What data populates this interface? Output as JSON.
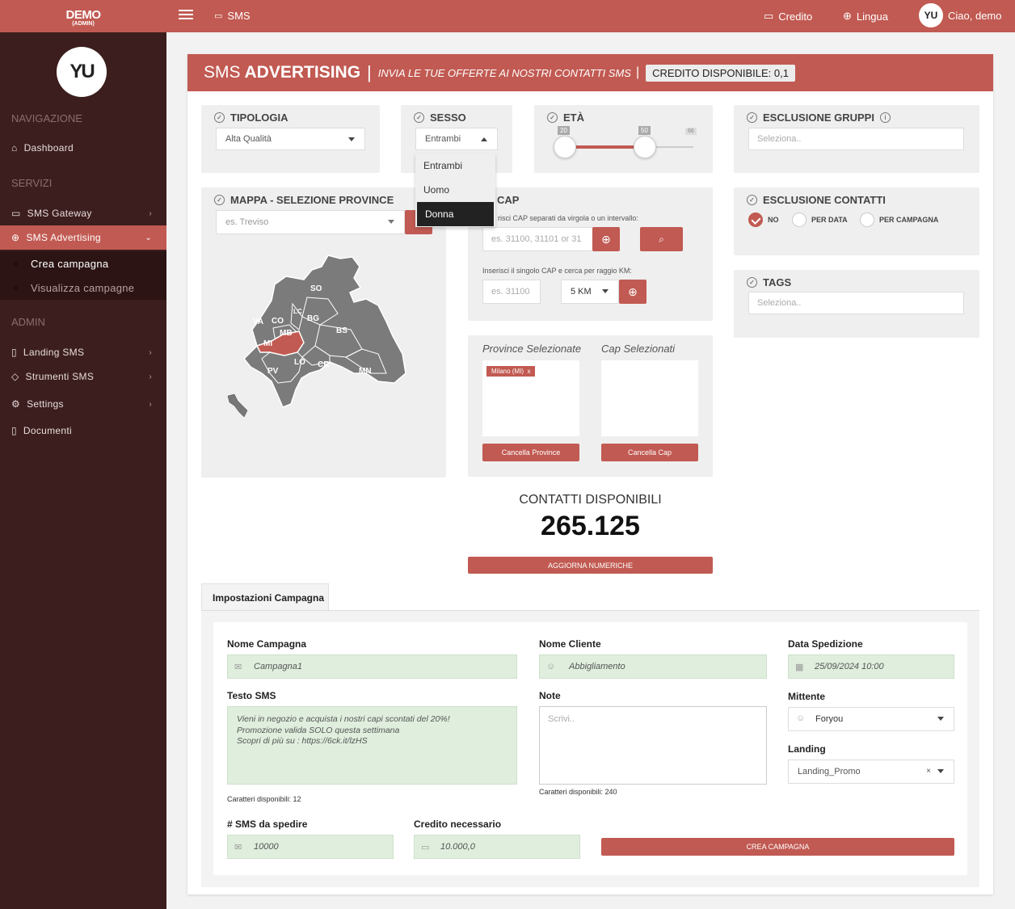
{
  "brand": {
    "name": "DEMO",
    "role": "(ADMIN)"
  },
  "topbar": {
    "sms": "SMS",
    "credito": "Credito",
    "lingua": "Lingua",
    "user": "Ciao, demo",
    "avatar": "YU"
  },
  "sidebar": {
    "logo": "YU",
    "sections": {
      "nav": "NAVIGAZIONE",
      "servizi": "SERVIZI",
      "admin": "ADMIN"
    },
    "items": {
      "dashboard": "Dashboard",
      "sms_gateway": "SMS Gateway",
      "sms_advertising": "SMS Advertising",
      "crea_campagna": "Crea campagna",
      "visualizza_campagne": "Visualizza campagne",
      "landing_sms": "Landing SMS",
      "strumenti_sms": "Strumenti SMS",
      "settings": "Settings",
      "documenti": "Documenti"
    }
  },
  "header": {
    "title_light": "SMS",
    "title_bold": "ADVERTISING",
    "subtitle": "INVIA LE TUE OFFERTE AI NOSTRI CONTATTI SMS",
    "credit": "CREDITO DISPONIBILE: 0,1"
  },
  "tipologia": {
    "title": "TIPOLOGIA",
    "value": "Alta Qualità"
  },
  "sesso": {
    "title": "SESSO",
    "value": "Entrambi",
    "options": [
      "Entrambi",
      "Uomo",
      "Donna"
    ],
    "highlighted": "Donna"
  },
  "eta": {
    "title": "ETÀ",
    "min": "20",
    "max": "50",
    "limit": "66",
    "range_min": 20,
    "range_max": 50
  },
  "esclusione_gruppi": {
    "title": "ESCLUSIONE GRUPPI",
    "placeholder": "Seleziona.."
  },
  "mappa": {
    "title": "MAPPA - SELEZIONE PROVINCE",
    "placeholder": "es. Treviso",
    "provinces": [
      "SO",
      "VA",
      "CO",
      "LC",
      "BG",
      "MB",
      "BS",
      "MI",
      "LO",
      "CR",
      "MN",
      "PV"
    ],
    "selected_province": "MI"
  },
  "cap": {
    "title": "CAP",
    "hint1": "risci CAP separati da virgola o un intervallo:",
    "placeholder1": "es. 31100, 31101 or 31",
    "hint2": "Inserisci il singolo CAP e cerca per raggio KM:",
    "placeholder2": "es. 31100",
    "radius": "5 KM"
  },
  "esclusione_contatti": {
    "title": "ESCLUSIONE CONTATTI",
    "options": [
      "NO",
      "PER DATA",
      "PER CAMPAGNA"
    ]
  },
  "tags": {
    "title": "TAGS",
    "placeholder": "Seleziona.."
  },
  "selezionati": {
    "province_title": "Province Selezionate",
    "cap_title": "Cap Selezionati",
    "province_tag": "Milano (MI)",
    "province_tag_x": "x",
    "btn_province": "Cancella Province",
    "btn_cap": "Cancella Cap"
  },
  "contatti": {
    "label": "CONTATTI DISPONIBILI",
    "value": "265.125",
    "btn": "AGGIORNA NUMERICHE"
  },
  "campaign": {
    "tab": "Impostazioni Campagna",
    "nome_label": "Nome Campagna",
    "nome_value": "Campagna1",
    "cliente_label": "Nome Cliente",
    "cliente_value": "Abbigliamento",
    "data_label": "Data Spedizione",
    "data_value": "25/09/2024 10:00",
    "testo_label": "Testo SMS",
    "testo_line1": "Vieni in negozio e acquista i nostri capi scontati del 20%!",
    "testo_line2": "Promozione valida SOLO questa settimana",
    "testo_line3": "Scopri di più su : https://6ck.it/lzHS",
    "testo_chars": "Caratteri disponibili: 12",
    "note_label": "Note",
    "note_placeholder": "Scrivi..",
    "note_chars": "Caratteri disponibili: 240",
    "mittente_label": "Mittente",
    "mittente_value": "Foryou",
    "landing_label": "Landing",
    "landing_value": "Landing_Promo",
    "landing_clear": "×",
    "sms_label": "# SMS da spedire",
    "sms_value": "10000",
    "credito_label": "Credito necessario",
    "credito_value": "10.000,0",
    "btn": "CREA CAMPAGNA"
  },
  "colors": {
    "accent": "#c15a52",
    "sidebar": "#3c1e1e",
    "field_green": "#dfeedd"
  }
}
